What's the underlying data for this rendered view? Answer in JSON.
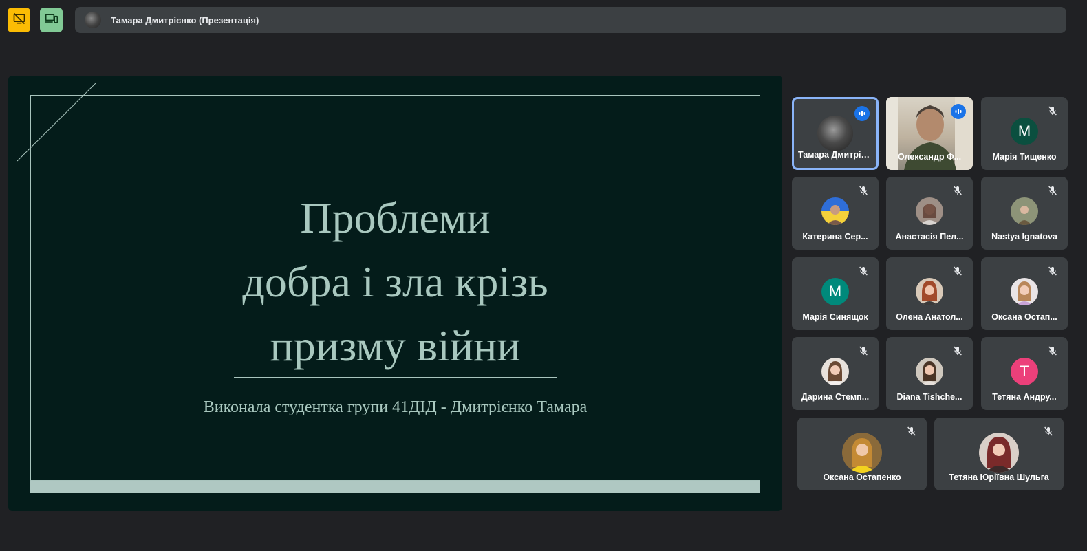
{
  "topbar": {
    "title": "Тамара Дмитрієнко (Презентація)",
    "present_icon": "presentation-off-icon",
    "device_icon": "devices-icon",
    "present_color": "#fbbc04",
    "device_color": "#81c995"
  },
  "slide": {
    "title": "Проблеми\nдобра і зла крізь\nпризму війни",
    "subtitle": "Виконала студентка групи 41ДІД - Дмитрієнко Тамара",
    "background": "#041c1a",
    "text_color": "#a9c8bf"
  },
  "participants": [
    {
      "name": "Тамара Дмитрієнко",
      "status": "speaking",
      "avatar": "photo"
    },
    {
      "name": "Олександр Ф...",
      "status": "speaking",
      "avatar": "video"
    },
    {
      "name": "Марія Тищенко",
      "status": "muted",
      "avatar": "M"
    },
    {
      "name": "Катерина Сер...",
      "status": "muted",
      "avatar": "photo"
    },
    {
      "name": "Анастасія Пел...",
      "status": "muted",
      "avatar": "photo"
    },
    {
      "name": "Nastya Ignatova",
      "status": "muted",
      "avatar": "photo"
    },
    {
      "name": "Марія Синящок",
      "status": "muted",
      "avatar": "M"
    },
    {
      "name": "Олена Анатол...",
      "status": "muted",
      "avatar": "photo"
    },
    {
      "name": "Оксана Остап...",
      "status": "muted",
      "avatar": "photo"
    },
    {
      "name": "Дарина Стемп...",
      "status": "muted",
      "avatar": "photo"
    },
    {
      "name": "Diana Tishche...",
      "status": "muted",
      "avatar": "photo"
    },
    {
      "name": "Тетяна Андру...",
      "status": "muted",
      "avatar": "T"
    },
    {
      "name": "Оксана Остапенко",
      "status": "muted",
      "avatar": "photo"
    },
    {
      "name": "Тетяна Юріївна Шульга",
      "status": "muted",
      "avatar": "photo"
    }
  ],
  "colors": {
    "accent": "#8ab4f8",
    "speaking": "#1a73e8",
    "avatar_m1": "#0b4f3f",
    "avatar_m2": "#00897b",
    "avatar_t": "#ec407a"
  }
}
